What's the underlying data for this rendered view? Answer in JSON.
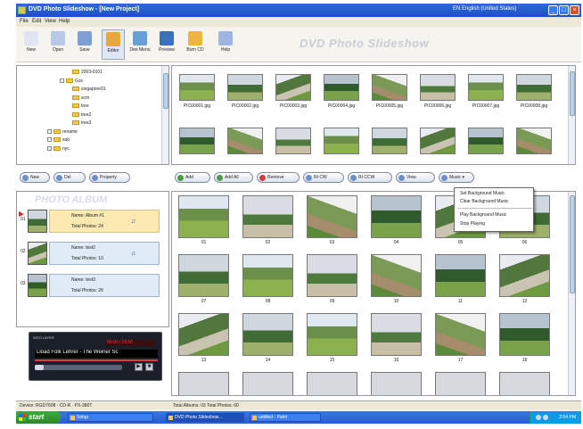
{
  "window": {
    "title": "DVD Photo Slideshow - [New Project]",
    "language": "EN English (United States)",
    "minimize": "_",
    "maximize": "□",
    "close": "×"
  },
  "menu": [
    "File",
    "Edit",
    "View",
    "Help"
  ],
  "toolbar": {
    "buttons": [
      {
        "label": "New",
        "color": "#dfe6f2"
      },
      {
        "label": "Open",
        "color": "#b7c9e6"
      },
      {
        "label": "Save",
        "color": "#7f9fd3"
      },
      {
        "label": "Editor",
        "color": "#e6a93b"
      },
      {
        "label": "Dee Menu",
        "color": "#67a0d6"
      },
      {
        "label": "Preview",
        "color": "#3a6fc4"
      },
      {
        "label": "Burn CD",
        "color": "#f0b441"
      },
      {
        "label": "Help",
        "color": "#9fb5e0"
      }
    ],
    "brand": "DVD Photo Slideshow"
  },
  "tree": {
    "rows": [
      {
        "label": "2003-0101",
        "indent": 3
      },
      {
        "label": "Goc",
        "indent": 2
      },
      {
        "label": "singapore01",
        "indent": 3
      },
      {
        "label": "scm",
        "indent": 3
      },
      {
        "label": "tree",
        "indent": 3
      },
      {
        "label": "tree2",
        "indent": 3
      },
      {
        "label": "tree3",
        "indent": 3
      },
      {
        "label": "rename",
        "indent": 1
      },
      {
        "label": "sub",
        "indent": 1
      },
      {
        "label": "nyc",
        "indent": 1
      }
    ]
  },
  "files": [
    {
      "name": "PIC00001.jpg"
    },
    {
      "name": "PIC00002.jpg"
    },
    {
      "name": "PIC00003.jpg"
    },
    {
      "name": "PIC00004.jpg"
    },
    {
      "name": "PIC00005.jpg"
    },
    {
      "name": "PIC00006.jpg"
    },
    {
      "name": "PIC00007.jpg"
    },
    {
      "name": "PIC00008.jpg"
    }
  ],
  "album_buttons": [
    {
      "label": "New",
      "color": "#6f8fc8"
    },
    {
      "label": "Del",
      "color": "#6f8fc8"
    },
    {
      "label": "Property",
      "color": "#6f8fc8"
    }
  ],
  "photo_buttons": [
    {
      "label": "Add",
      "color": "#4a9a4a"
    },
    {
      "label": "Add All",
      "color": "#4a9a4a"
    },
    {
      "label": "Remove",
      "color": "#c84040"
    },
    {
      "label": "Rt CW",
      "color": "#6f8fc8"
    },
    {
      "label": "Rt CCW",
      "color": "#6f8fc8"
    },
    {
      "label": "View",
      "color": "#6f8fc8"
    },
    {
      "label": "Music",
      "color": "#6f8fc8"
    }
  ],
  "album_panel": {
    "logo": "PHOTO ALBUM",
    "albums": [
      {
        "num": "01",
        "name": "Name: Album #1",
        "total": "Total Photos: 24"
      },
      {
        "num": "02",
        "name": "Name: test2",
        "total": "Total Photos: 10"
      },
      {
        "num": "03",
        "name": "Name: test3",
        "total": "Total Photos: 26"
      }
    ]
  },
  "player": {
    "header": "WCO LAYER",
    "lcd": "00:00 / 03:50",
    "track": "Lload Folk Lehrer - The Weiner Sc",
    "progress": 0.1
  },
  "photos": [
    {
      "num": "01"
    },
    {
      "num": "02"
    },
    {
      "num": "03"
    },
    {
      "num": "04"
    },
    {
      "num": "05"
    },
    {
      "num": "06"
    },
    {
      "num": "07"
    },
    {
      "num": "08"
    },
    {
      "num": "09"
    },
    {
      "num": "10"
    },
    {
      "num": "11"
    },
    {
      "num": "12"
    },
    {
      "num": "13"
    },
    {
      "num": "14"
    },
    {
      "num": "15"
    },
    {
      "num": "16"
    },
    {
      "num": "17"
    },
    {
      "num": "18"
    },
    {
      "num": ""
    },
    {
      "num": ""
    },
    {
      "num": ""
    },
    {
      "num": ""
    },
    {
      "num": ""
    },
    {
      "num": ""
    }
  ],
  "context_menu": {
    "items": [
      "Set Background Music",
      "Clear Background Music",
      "Play Background Music",
      "Stop Playing"
    ]
  },
  "status": {
    "device": "Device: RGD7608 · CD-R · PX-380T",
    "albums": "Total Albums: 03 Total Photos: 60"
  },
  "taskbar": {
    "start": "start",
    "tasks": [
      {
        "label": "Setup"
      },
      {
        "label": "DVD Photo Slideshow..."
      },
      {
        "label": "untitled - Paint"
      }
    ],
    "clock": "2:54 PM"
  }
}
